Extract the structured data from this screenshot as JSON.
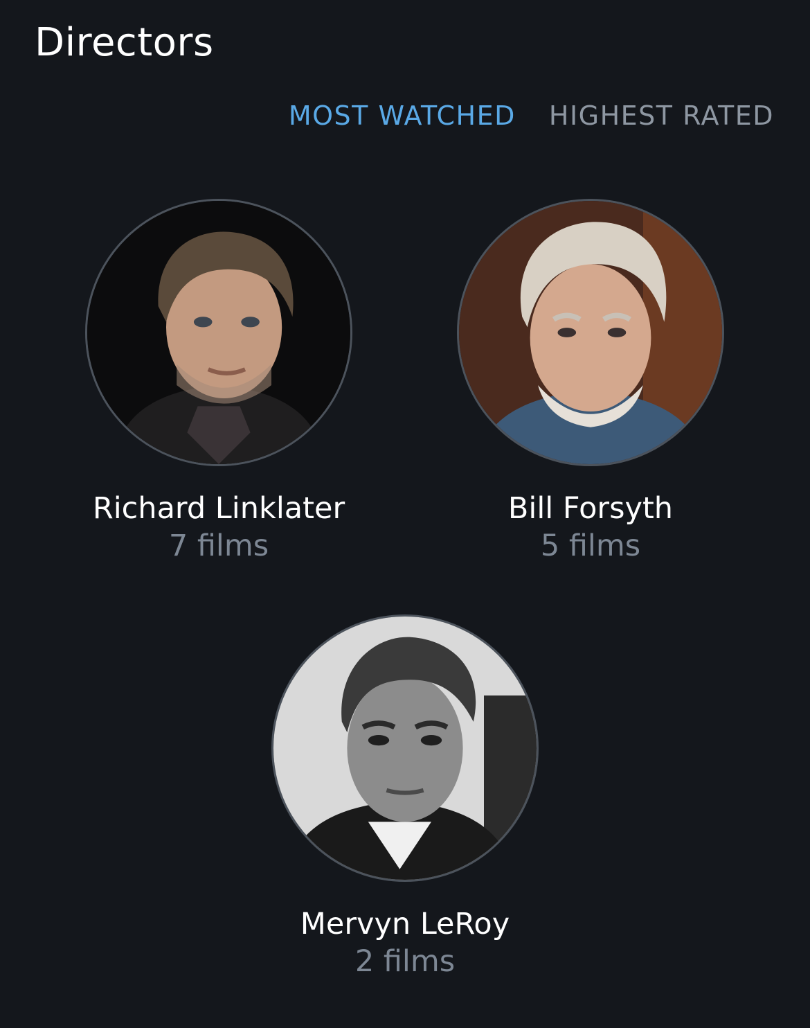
{
  "page": {
    "title": "Directors"
  },
  "sort_tabs": {
    "active_color": "#5aa9e6",
    "inactive_color": "#8e97a2",
    "items": [
      {
        "label": "MOST WATCHED",
        "active": true
      },
      {
        "label": "HIGHEST RATED",
        "active": false
      }
    ]
  },
  "directors": [
    {
      "name": "Richard Linklater",
      "count": "7 films",
      "photo_icon": "person-portrait-icon"
    },
    {
      "name": "Bill Forsyth",
      "count": "5 films",
      "photo_icon": "person-portrait-icon"
    },
    {
      "name": "Mervyn LeRoy",
      "count": "2 films",
      "photo_icon": "person-portrait-icon"
    }
  ]
}
